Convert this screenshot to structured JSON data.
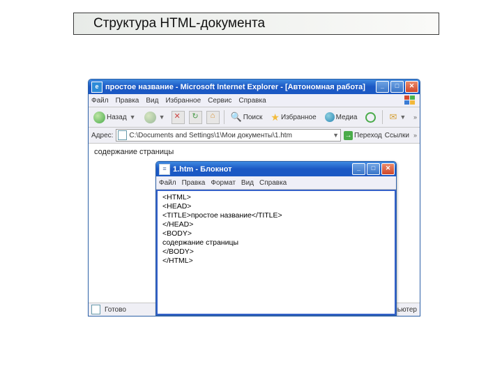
{
  "slide": {
    "title": "Структура HTML-документа"
  },
  "ie": {
    "title": "простое название - Microsoft Internet Explorer - [Автономная работа]",
    "menu": {
      "file": "Файл",
      "edit": "Правка",
      "view": "Вид",
      "favorites": "Избранное",
      "tools": "Сервис",
      "help": "Справка"
    },
    "toolbar": {
      "back": "Назад",
      "forward_aria": "вперёд",
      "search": "Поиск",
      "favorites": "Избранное",
      "media": "Медиа"
    },
    "address": {
      "label": "Адрес:",
      "path": "C:\\Documents and Settings\\1\\Мои документы\\1.htm",
      "go": "Переход",
      "links": "Ссылки"
    },
    "page_content": "содержание страницы",
    "status": {
      "ready": "Готово",
      "zone": "Мой компьютер"
    }
  },
  "notepad": {
    "title": "1.htm - Блокнот",
    "menu": {
      "file": "Файл",
      "edit": "Правка",
      "format": "Формат",
      "view": "Вид",
      "help": "Справка"
    },
    "lines": [
      "<HTML>",
      "<HEAD>",
      "<TITLE>простое название</TITLE>",
      "</HEAD>",
      "<BODY>",
      "содержание страницы",
      "</BODY>",
      "</HTML>"
    ]
  }
}
